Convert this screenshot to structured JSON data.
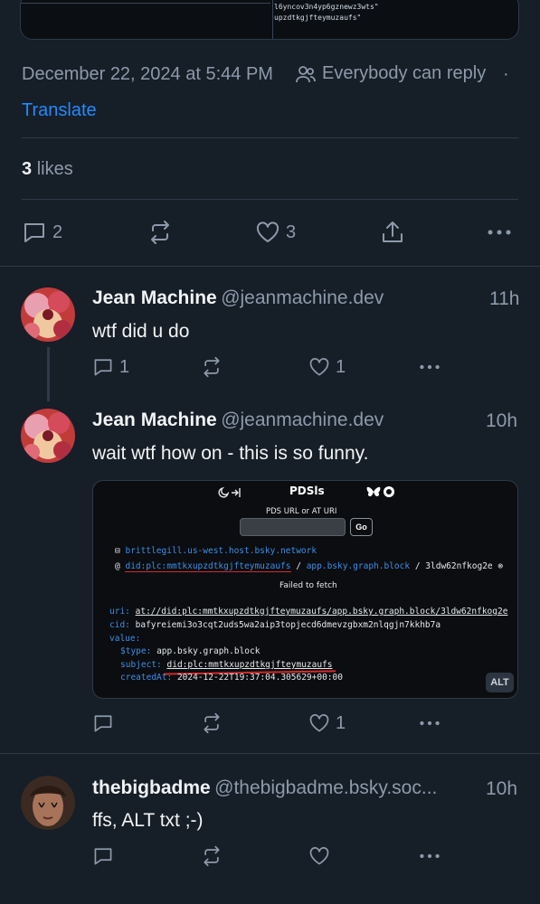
{
  "top_embed": {
    "line1": "l6yncov3n4yp6gznewz3wts\"",
    "line2": "upzdtkgjfteymuzaufs\""
  },
  "main_post": {
    "timestamp": "December 22, 2024 at 5:44 PM",
    "reply_setting": "Everybody can reply",
    "separator": "·",
    "translate": "Translate",
    "likes_count": "3",
    "likes_label": "likes",
    "reply_count": "2",
    "like_count": "3"
  },
  "replies": [
    {
      "name": "Jean Machine",
      "handle": "@jeanmachine.dev",
      "time": "11h",
      "text": "wtf did u do",
      "reply_count": "1",
      "like_count": "1"
    },
    {
      "name": "Jean Machine",
      "handle": "@jeanmachine.dev",
      "time": "10h",
      "text": "wait wtf how on - this is so funny.",
      "like_count": "1",
      "embed": {
        "app_title": "PDSls",
        "input_label": "PDS URL or AT URI",
        "go_label": "Go",
        "host": "brittlegill.us-west.host.bsky.network",
        "did": "did:plc:mmtkxupzdtkgjfteymuzaufs",
        "path_sep": "/",
        "collection": "app.bsky.graph.block",
        "rkey": "3ldw62nfkog2e",
        "error": "Failed to fetch",
        "uri_label": "uri:",
        "uri_value": "at://did:plc:mmtkxupzdtkgjfteymuzaufs/app.bsky.graph.block/3ldw62nfkog2e",
        "cid_label": "cid:",
        "cid_value": "bafyreiemi3o3cqt2uds5wa2aip3topjecd6dmevzgbxm2nlqgjn7kkhb7a",
        "value_label": "value:",
        "type_label": "$type:",
        "type_value": "app.bsky.graph.block",
        "subject_label": "subject:",
        "subject_value": "did:plc:mmtkxupzdtkgjfteymuzaufs",
        "created_label": "createdAt:",
        "created_value": "2024-12-22T19:37:04.305629+00:00",
        "alt_badge": "ALT"
      }
    },
    {
      "name": "thebigbadme",
      "handle": "@thebigbadme.bsky.soc...",
      "time": "10h",
      "text": "ffs, ALT txt ;-)"
    }
  ],
  "colors": {
    "background": "#161e27",
    "accent": "#208bfe",
    "muted": "#8d9aab"
  }
}
